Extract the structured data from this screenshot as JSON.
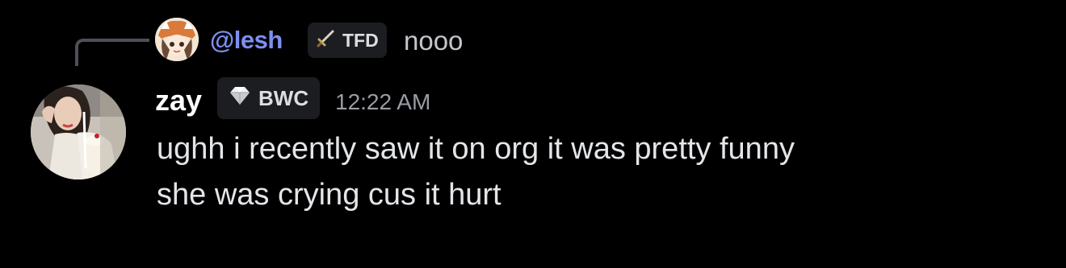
{
  "reply": {
    "author": "@lesh",
    "guild_tag": "TFD",
    "tag_icon": "sword-icon",
    "text": "nooo"
  },
  "message": {
    "author": "zay",
    "guild_tag": "BWC",
    "tag_icon": "diamond-icon",
    "timestamp": "12:22 AM",
    "lines": [
      "ughh i recently saw it on org it was pretty funny",
      "she was crying cus it hurt"
    ]
  },
  "colors": {
    "background": "#000000",
    "reply_author": "#7d8ff0",
    "author": "#ffffff",
    "message_text": "#e3e5e8",
    "timestamp": "#9a9ca4",
    "tag_background": "#1c1d21"
  }
}
